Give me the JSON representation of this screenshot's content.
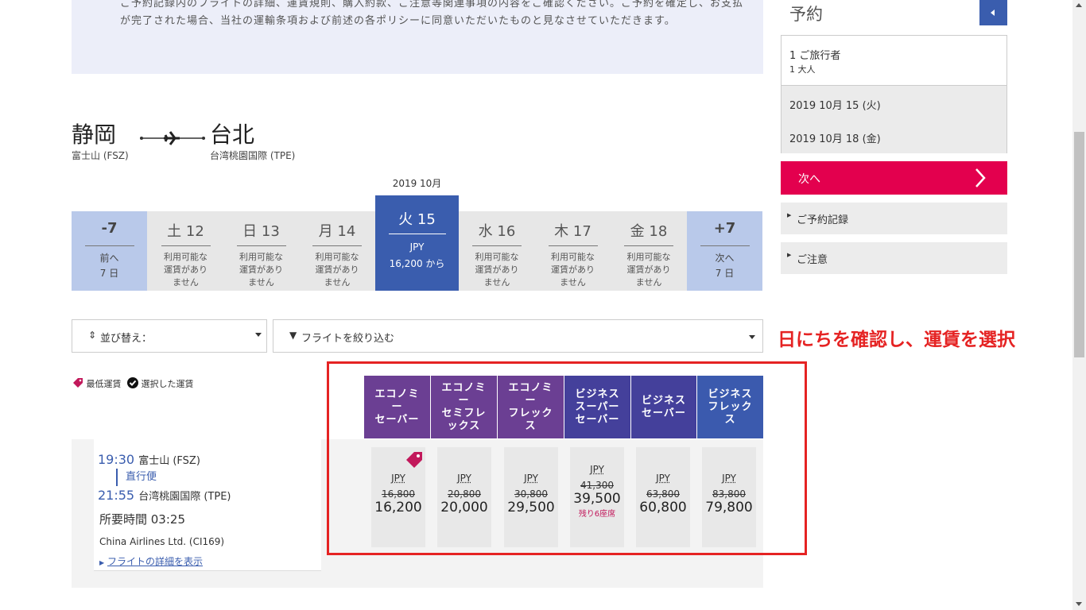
{
  "notice": {
    "text": "ご予約記録内のフライトの詳細、運賃規則、購入約款、ご注意等関連事項の内容をご確認ください。ご予約を確定し、お支払が完了された場合、当社の運輸条項および前述の各ポリシーに同意いただいたものと見なさせていただきます。"
  },
  "route": {
    "origin_city": "静岡",
    "origin_airport": "富士山 (FSZ)",
    "dest_city": "台北",
    "dest_airport": "台湾桃園国際 (TPE)"
  },
  "date_strip": {
    "month": "2019 10月",
    "prev": {
      "d": "-7",
      "l1": "前へ",
      "l2": "7 日"
    },
    "next": {
      "d": "+7",
      "l1": "次へ",
      "l2": "7 日"
    },
    "days": [
      {
        "d": "土 12",
        "l1": "利用可能な",
        "l2": "運賃があり",
        "l3": "ません"
      },
      {
        "d": "日 13",
        "l1": "利用可能な",
        "l2": "運賃があり",
        "l3": "ません"
      },
      {
        "d": "月 14",
        "l1": "利用可能な",
        "l2": "運賃があり",
        "l3": "ません"
      },
      {
        "d": "火 15",
        "l1": "JPY",
        "l2": "16,200 から"
      },
      {
        "d": "水 16",
        "l1": "利用可能な",
        "l2": "運賃があり",
        "l3": "ません"
      },
      {
        "d": "木 17",
        "l1": "利用可能な",
        "l2": "運賃があり",
        "l3": "ません"
      },
      {
        "d": "金 18",
        "l1": "利用可能な",
        "l2": "運賃があり",
        "l3": "ません"
      }
    ]
  },
  "controls": {
    "sort_label": "並び替え：",
    "filter_label": "フライトを絞り込む"
  },
  "annotation": "日にちを確認し、運賃を選択",
  "legend": {
    "lowest": "最低運賃",
    "selected": "選択した運賃"
  },
  "fare_headers": [
    {
      "l1": "エコノミ",
      "l2": "ー",
      "l3": "セーバー"
    },
    {
      "l1": "エコノミ",
      "l2": "ー",
      "l3": "セミフレ",
      "l4": "ックス"
    },
    {
      "l1": "エコノミ",
      "l2": "ー",
      "l3": "フレック",
      "l4": "ス"
    },
    {
      "l1": "ビジネス",
      "l2": "スーパー",
      "l3": "セーバー"
    },
    {
      "l1": "ビジネス",
      "l2": "セーバー"
    },
    {
      "l1": "ビジネス",
      "l2": "フレック",
      "l3": "ス"
    }
  ],
  "flight": {
    "dep_time": "19:30",
    "dep_airport": "富士山 (FSZ)",
    "type": "直行便",
    "arr_time": "21:55",
    "arr_airport": "台湾桃園国際 (TPE)",
    "duration": "所要時間 03:25",
    "carrier": "China Airlines Ltd. (CI169)",
    "details_link": "フライトの詳細を表示"
  },
  "fares": [
    {
      "cur": "JPY",
      "old": "16,800",
      "now": "16,200",
      "seats": ""
    },
    {
      "cur": "JPY",
      "old": "20,800",
      "now": "20,000",
      "seats": ""
    },
    {
      "cur": "JPY",
      "old": "30,800",
      "now": "29,500",
      "seats": ""
    },
    {
      "cur": "JPY",
      "old": "41,300",
      "now": "39,500",
      "seats": "残り6座席"
    },
    {
      "cur": "JPY",
      "old": "63,800",
      "now": "60,800",
      "seats": ""
    },
    {
      "cur": "JPY",
      "old": "83,800",
      "now": "79,800",
      "seats": ""
    }
  ],
  "booking": {
    "title": "予約",
    "travelers": "1 ご旅行者",
    "adults": "1 大人",
    "depart_date": "2019 10月 15 (火)",
    "return_date": "2019 10月 18 (金)",
    "next_button": "次へ",
    "record": "ご予約記録",
    "notes": "ご注意"
  },
  "colors": {
    "accent": "#3a5dae",
    "brand_red": "#e3004e",
    "annotation": "#e52323",
    "economy": "#6b3f93",
    "business": "#44409b"
  }
}
